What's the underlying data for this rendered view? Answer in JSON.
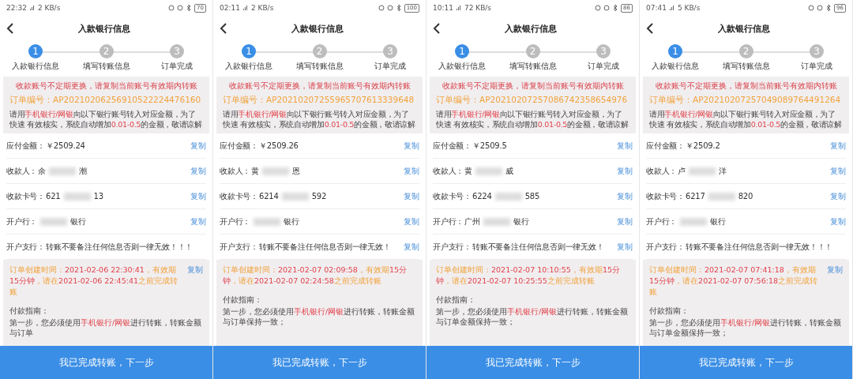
{
  "screens": [
    {
      "status_bar": {
        "time": "22:32",
        "speed": "2 KB/s",
        "battery": "70"
      },
      "title": "入款银行信息",
      "steps": [
        {
          "number": "1",
          "label": "入款银行信息",
          "active": true
        },
        {
          "number": "2",
          "label": "填写转账信息",
          "active": false
        },
        {
          "number": "3",
          "label": "订单完成",
          "active": false
        }
      ],
      "notice": "收款账号不定期更换，请复制当前账号有效期内转账",
      "order_label": "订单编号：",
      "order_no": "AP20210206256910522224476160",
      "instruction": [
        {
          "kind": "plain",
          "text": "请用"
        },
        {
          "kind": "red",
          "text": "手机银行/网银"
        },
        {
          "kind": "plain",
          "text": "向以下银行账号转入对应金额，为了快速 有效核实，系统自动增加"
        },
        {
          "kind": "red",
          "text": "0.01-0.5"
        },
        {
          "kind": "plain",
          "text": "的金额，敬请谅解"
        }
      ],
      "rows": [
        {
          "label": "应付金额：",
          "value": [
            {
              "kind": "text",
              "text": "￥2509.24"
            }
          ],
          "copy": "复制"
        },
        {
          "label": "收款人：",
          "value": [
            {
              "kind": "text",
              "text": "余"
            },
            {
              "kind": "mask"
            },
            {
              "kind": "text",
              "text": "潮"
            }
          ],
          "copy": "复制"
        },
        {
          "label": "收款卡号：",
          "value": [
            {
              "kind": "text",
              "text": "621"
            },
            {
              "kind": "mask"
            },
            {
              "kind": "text",
              "text": "13"
            }
          ],
          "copy": "复制"
        },
        {
          "label": "开户行：",
          "value": [
            {
              "kind": "mask"
            },
            {
              "kind": "text",
              "text": "银行"
            }
          ],
          "copy": "复制"
        },
        {
          "label": "开户支行：",
          "value": [
            {
              "kind": "text",
              "text": "转账不要备注任何信息否则一律无效！！！"
            }
          ]
        }
      ],
      "time_info": {
        "segments": [
          {
            "kind": "orange",
            "text": "订单创建时间："
          },
          {
            "kind": "red",
            "text": "2021-02-06 22:30:41"
          },
          {
            "kind": "orange",
            "text": "，有效期"
          },
          {
            "kind": "red",
            "text": "15分钟"
          },
          {
            "kind": "orange",
            "text": "，请在"
          },
          {
            "kind": "red",
            "text": "2021-02-06 22:45:41"
          },
          {
            "kind": "orange",
            "text": "之前完成转账"
          }
        ],
        "copy": "复制"
      },
      "guide_title": "付款指南：",
      "guide": [
        {
          "kind": "plain",
          "text": "第一步，您必须使用"
        },
        {
          "kind": "red",
          "text": "手机银行/网银"
        },
        {
          "kind": "plain",
          "text": "进行转账，转账金额与订单"
        }
      ],
      "button": "我已完成转账，下一步"
    },
    {
      "status_bar": {
        "time": "02:11",
        "speed": "2 KB/s",
        "battery": "100"
      },
      "title": "入款银行信息",
      "steps": [
        {
          "number": "1",
          "label": "入款银行信息",
          "active": true
        },
        {
          "number": "2",
          "label": "填写转账信息",
          "active": false
        },
        {
          "number": "3",
          "label": "订单完成",
          "active": false
        }
      ],
      "notice": "收款账号不定期更换，请复制当前账号有效期内转账",
      "order_label": "订单编号：",
      "order_no": "AP20210207255965707613339648",
      "instruction": [
        {
          "kind": "plain",
          "text": "请用"
        },
        {
          "kind": "red",
          "text": "手机银行/网银"
        },
        {
          "kind": "plain",
          "text": "向以下银行账号转入对应金额，为了快速 有效核实，系统自动增加"
        },
        {
          "kind": "red",
          "text": "0.01-0.5"
        },
        {
          "kind": "plain",
          "text": "的金额，敬请谅解"
        }
      ],
      "rows": [
        {
          "label": "应付金额：",
          "value": [
            {
              "kind": "text",
              "text": "￥2509.26"
            }
          ],
          "copy": "复制"
        },
        {
          "label": "收款人：",
          "value": [
            {
              "kind": "text",
              "text": "黄"
            },
            {
              "kind": "mask"
            },
            {
              "kind": "text",
              "text": "恩"
            }
          ],
          "copy": "复制"
        },
        {
          "label": "收款卡号：",
          "value": [
            {
              "kind": "text",
              "text": "6214"
            },
            {
              "kind": "mask"
            },
            {
              "kind": "text",
              "text": "592"
            }
          ],
          "copy": "复制"
        },
        {
          "label": "开户行：",
          "value": [
            {
              "kind": "mask"
            },
            {
              "kind": "text",
              "text": "银行"
            }
          ],
          "copy": "复制"
        },
        {
          "label": "开户支行：",
          "value": [
            {
              "kind": "text",
              "text": "转账不要备注任何信息否则一律无效！"
            }
          ],
          "copy": "复制"
        }
      ],
      "time_info": {
        "segments": [
          {
            "kind": "orange",
            "text": "订单创建时间："
          },
          {
            "kind": "red",
            "text": "2021-02-07 02:09:58"
          },
          {
            "kind": "orange",
            "text": "，有效期"
          },
          {
            "kind": "red",
            "text": "15分钟"
          },
          {
            "kind": "orange",
            "text": "，请在"
          },
          {
            "kind": "red",
            "text": "2021-02-07 02:24:58"
          },
          {
            "kind": "orange",
            "text": "之前完成转账"
          }
        ]
      },
      "guide_title": "付款指南：",
      "guide": [
        {
          "kind": "plain",
          "text": "第一步，您必须使用"
        },
        {
          "kind": "red",
          "text": "手机银行/网银"
        },
        {
          "kind": "plain",
          "text": "进行转账，转账金额与订单保持一致；"
        }
      ],
      "button": "我已完成转账，下一步"
    },
    {
      "status_bar": {
        "time": "10:11",
        "speed": "72 KB/s",
        "battery": "86"
      },
      "title": "入款银行信息",
      "steps": [
        {
          "number": "1",
          "label": "入款银行信息",
          "active": true
        },
        {
          "number": "2",
          "label": "填写转账信息",
          "active": false
        },
        {
          "number": "3",
          "label": "订单完成",
          "active": false
        }
      ],
      "notice": "收款账号不定期更换，请复制当前账号有效期内转账",
      "order_label": "订单编号：",
      "order_no": "AP20210207257086742358654976",
      "instruction": [
        {
          "kind": "plain",
          "text": "请用"
        },
        {
          "kind": "red",
          "text": "手机银行/网银"
        },
        {
          "kind": "plain",
          "text": "向以下银行账号转入对应金额，为了快速 有效核实，系统自动增加"
        },
        {
          "kind": "red",
          "text": "0.01-0.5"
        },
        {
          "kind": "plain",
          "text": "的金额，敬请谅解"
        }
      ],
      "rows": [
        {
          "label": "应付金额：",
          "value": [
            {
              "kind": "text",
              "text": "￥2509.5"
            }
          ],
          "copy": "复制"
        },
        {
          "label": "收款人：",
          "value": [
            {
              "kind": "text",
              "text": "黄"
            },
            {
              "kind": "mask"
            },
            {
              "kind": "text",
              "text": "威"
            }
          ],
          "copy": "复制"
        },
        {
          "label": "收款卡号：",
          "value": [
            {
              "kind": "text",
              "text": "6224"
            },
            {
              "kind": "mask"
            },
            {
              "kind": "text",
              "text": "585"
            }
          ],
          "copy": "复制"
        },
        {
          "label": "开户行：",
          "value": [
            {
              "kind": "text",
              "text": "广州"
            },
            {
              "kind": "mask"
            },
            {
              "kind": "text",
              "text": "银行"
            }
          ],
          "copy": "复制"
        },
        {
          "label": "开户支行：",
          "value": [
            {
              "kind": "text",
              "text": "转账不要备注任何信息否则一律无效！"
            }
          ],
          "copy": "复制"
        }
      ],
      "time_info": {
        "segments": [
          {
            "kind": "orange",
            "text": "订单创建时间："
          },
          {
            "kind": "red",
            "text": "2021-02-07 10:10:55"
          },
          {
            "kind": "orange",
            "text": "，有效期"
          },
          {
            "kind": "red",
            "text": "15分钟"
          },
          {
            "kind": "orange",
            "text": "，请在"
          },
          {
            "kind": "red",
            "text": "2021-02-07 10:25:55"
          },
          {
            "kind": "orange",
            "text": "之前完成转账"
          }
        ]
      },
      "guide_title": "付款指南：",
      "guide": [
        {
          "kind": "plain",
          "text": "第一步，您必须使用"
        },
        {
          "kind": "red",
          "text": "手机银行/网银"
        },
        {
          "kind": "plain",
          "text": "进行转账，转账金额与订单金额保持一致；"
        }
      ],
      "button": "我已完成转账，下一步"
    },
    {
      "status_bar": {
        "time": "07:41",
        "speed": "5 KB/s",
        "battery": "96"
      },
      "title": "入款银行信息",
      "steps": [
        {
          "number": "1",
          "label": "入款银行信息",
          "active": true
        },
        {
          "number": "2",
          "label": "填写转账信息",
          "active": false
        },
        {
          "number": "3",
          "label": "订单完成",
          "active": false
        }
      ],
      "notice": "收款账号不定期更换，请复制当前账号有效期内转账",
      "order_label": "订单编号：",
      "order_no": "AP20210207257049089764491264",
      "instruction": [
        {
          "kind": "plain",
          "text": "请用"
        },
        {
          "kind": "red",
          "text": "手机银行/网银"
        },
        {
          "kind": "plain",
          "text": "向以下银行账号转入对应金额，为了快速 有效核实，系统自动增加"
        },
        {
          "kind": "red",
          "text": "0.01-0.5"
        },
        {
          "kind": "plain",
          "text": "的金额，敬请谅解"
        }
      ],
      "rows": [
        {
          "label": "应付金额：",
          "value": [
            {
              "kind": "text",
              "text": "￥2509.2"
            }
          ],
          "copy": "复制"
        },
        {
          "label": "收款人：",
          "value": [
            {
              "kind": "text",
              "text": "卢"
            },
            {
              "kind": "mask"
            },
            {
              "kind": "text",
              "text": "洋"
            }
          ],
          "copy": "复制"
        },
        {
          "label": "收款卡号：",
          "value": [
            {
              "kind": "text",
              "text": "6217"
            },
            {
              "kind": "mask"
            },
            {
              "kind": "text",
              "text": "820"
            }
          ],
          "copy": "复制"
        },
        {
          "label": "开户行：",
          "value": [
            {
              "kind": "mask"
            },
            {
              "kind": "text",
              "text": "银行"
            }
          ],
          "copy": "复制"
        },
        {
          "label": "开户支行：",
          "value": [
            {
              "kind": "text",
              "text": "转账不要备注任何信息否则一律无效！！！"
            }
          ]
        }
      ],
      "time_info": {
        "segments": [
          {
            "kind": "orange",
            "text": "订单创建时间："
          },
          {
            "kind": "red",
            "text": "2021-02-07 07:41:18"
          },
          {
            "kind": "orange",
            "text": "，有效期"
          },
          {
            "kind": "red",
            "text": "15分钟"
          },
          {
            "kind": "orange",
            "text": "，请在"
          },
          {
            "kind": "red",
            "text": "2021-02-07 07:56:18"
          },
          {
            "kind": "orange",
            "text": "之前完成转账"
          }
        ],
        "copy": "复制"
      },
      "guide_title": "付款指南：",
      "guide": [
        {
          "kind": "plain",
          "text": "第一步，您必须使用"
        },
        {
          "kind": "red",
          "text": "手机银行/网银"
        },
        {
          "kind": "plain",
          "text": "进行转账，转账金额与订单金额保持一致；"
        }
      ],
      "button": "我已完成转账，下一步"
    }
  ]
}
